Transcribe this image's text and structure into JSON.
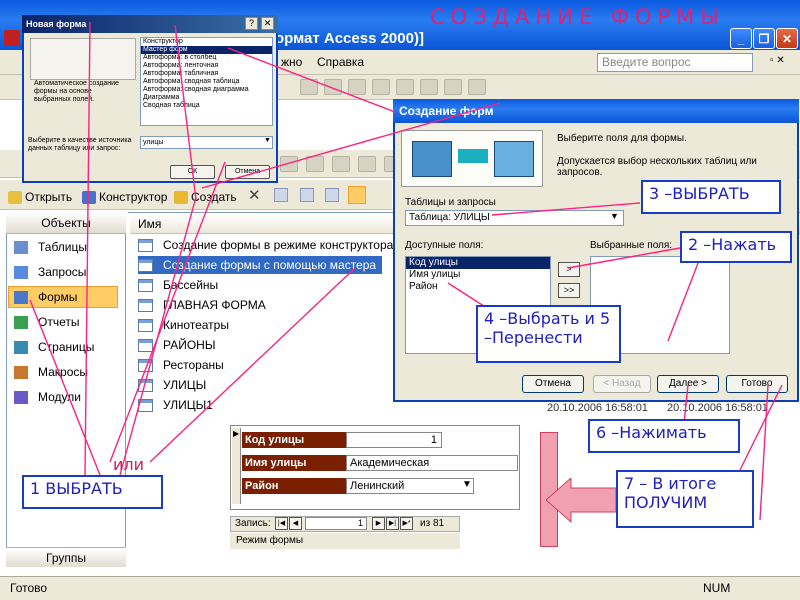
{
  "banner": "СОЗДАНИЕ ФОРМЫ",
  "window": {
    "title_fragment": "ормат Access 2000)]",
    "min": "_",
    "max": "❐",
    "close": "✕"
  },
  "menubar": {
    "items": [
      "жно",
      "Справка"
    ],
    "ask_placeholder": "Введите вопрос"
  },
  "db_toolbar": {
    "open": "Открыть",
    "designer": "Конструктор",
    "create": "Создать"
  },
  "objects": {
    "header": "Объекты",
    "items": [
      "Таблицы",
      "Запросы",
      "Формы",
      "Отчеты",
      "Страницы",
      "Макросы",
      "Модули"
    ],
    "selected": "Формы",
    "groups": "Группы"
  },
  "list": {
    "header": "Имя",
    "items": [
      "Создание формы в режиме конструктора",
      "Создание формы с помощью мастера",
      "Бассейны",
      "ГЛАВНАЯ ФОРМА",
      "Кинотеатры",
      "РАЙОНЫ",
      "Рестораны",
      "УЛИЦЫ",
      "УЛИЦЫ1"
    ],
    "selected": "Создание формы с помощью мастера",
    "dates": [
      "20.10.2006 16:58:01",
      "20.10.2006 16:58:01"
    ]
  },
  "new_form_dialog": {
    "title": "Новая форма",
    "help": "?",
    "close": "✕",
    "description": "Автоматическое создание формы на основе выбранных полей.",
    "options": [
      "Конструктор",
      "Мастер форм",
      "Автоформа: в столбец",
      "Автоформа: ленточная",
      "Автоформа: табличная",
      "Автоформа: сводная таблица",
      "Автоформа: сводная диаграмма",
      "Диаграмма",
      "Сводная таблица"
    ],
    "selected": "Мастер форм",
    "source_label": "Выберите в качестве источника данных таблицу или запрос:",
    "source_value": "улицы",
    "ok": "ОК",
    "cancel": "Отмена"
  },
  "wizard": {
    "title": "Создание форм",
    "prompt": "Выберите поля для формы.",
    "hint": "Допускается выбор нескольких таблиц или запросов.",
    "tables_label": "Таблицы и запросы",
    "table_value": "Таблица: УЛИЦЫ",
    "available_label": "Доступные поля:",
    "selected_label": "Выбранные поля:",
    "available_fields": [
      "Код улицы",
      "Имя улицы",
      "Район"
    ],
    "add_one": ">",
    "add_all": ">>",
    "remove_all": "<<",
    "cancel": "Отмена",
    "back": "< Назад",
    "next": "Далее >",
    "finish": "Готово"
  },
  "preview_form": {
    "fields": [
      {
        "label": "Код улицы",
        "value": "1"
      },
      {
        "label": "Имя улицы",
        "value": "Академическая"
      },
      {
        "label": "Район",
        "value": "Ленинский"
      }
    ],
    "record_label": "Запись:",
    "record_number": "1",
    "record_total": "из 81",
    "mode": "Режим формы"
  },
  "status": {
    "left": "Готово",
    "right": "NUM"
  },
  "annotations": {
    "step1": "1 ВЫБРАТЬ",
    "or": "или",
    "step2": "2 –Нажать",
    "step3": "3 –ВЫБРАТЬ",
    "step4": "4 –Выбрать и 5 –Перенести",
    "step6": "6 –Нажимать",
    "step7": "7 – В итоге ПОЛУЧИМ"
  },
  "colors": {
    "annotation_line": "#ff2080",
    "banner": "#e0207a",
    "callout_border": "#1a3ac8",
    "selection": "#316ac5",
    "form_label": "#7a1f00"
  }
}
